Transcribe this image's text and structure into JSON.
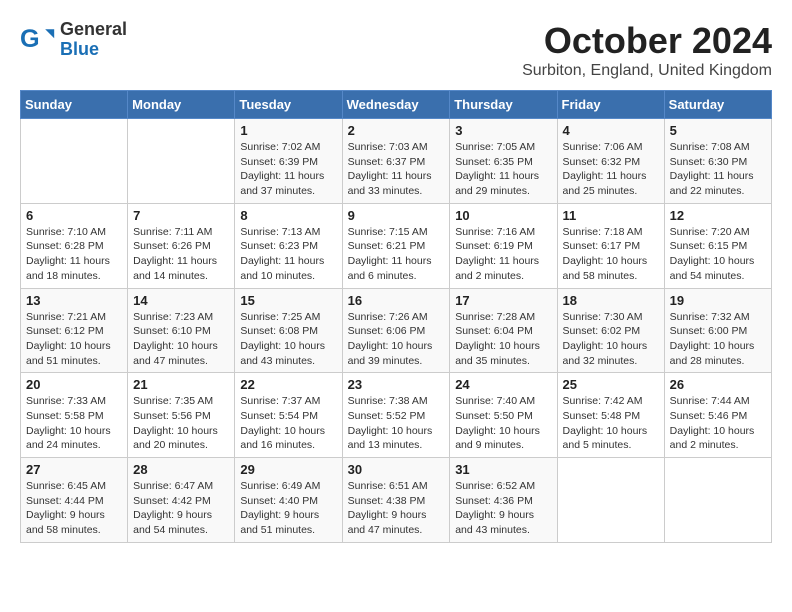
{
  "header": {
    "logo_general": "General",
    "logo_blue": "Blue",
    "month": "October 2024",
    "location": "Surbiton, England, United Kingdom"
  },
  "weekdays": [
    "Sunday",
    "Monday",
    "Tuesday",
    "Wednesday",
    "Thursday",
    "Friday",
    "Saturday"
  ],
  "weeks": [
    [
      {
        "day": "",
        "info": ""
      },
      {
        "day": "",
        "info": ""
      },
      {
        "day": "1",
        "info": "Sunrise: 7:02 AM\nSunset: 6:39 PM\nDaylight: 11 hours and 37 minutes."
      },
      {
        "day": "2",
        "info": "Sunrise: 7:03 AM\nSunset: 6:37 PM\nDaylight: 11 hours and 33 minutes."
      },
      {
        "day": "3",
        "info": "Sunrise: 7:05 AM\nSunset: 6:35 PM\nDaylight: 11 hours and 29 minutes."
      },
      {
        "day": "4",
        "info": "Sunrise: 7:06 AM\nSunset: 6:32 PM\nDaylight: 11 hours and 25 minutes."
      },
      {
        "day": "5",
        "info": "Sunrise: 7:08 AM\nSunset: 6:30 PM\nDaylight: 11 hours and 22 minutes."
      }
    ],
    [
      {
        "day": "6",
        "info": "Sunrise: 7:10 AM\nSunset: 6:28 PM\nDaylight: 11 hours and 18 minutes."
      },
      {
        "day": "7",
        "info": "Sunrise: 7:11 AM\nSunset: 6:26 PM\nDaylight: 11 hours and 14 minutes."
      },
      {
        "day": "8",
        "info": "Sunrise: 7:13 AM\nSunset: 6:23 PM\nDaylight: 11 hours and 10 minutes."
      },
      {
        "day": "9",
        "info": "Sunrise: 7:15 AM\nSunset: 6:21 PM\nDaylight: 11 hours and 6 minutes."
      },
      {
        "day": "10",
        "info": "Sunrise: 7:16 AM\nSunset: 6:19 PM\nDaylight: 11 hours and 2 minutes."
      },
      {
        "day": "11",
        "info": "Sunrise: 7:18 AM\nSunset: 6:17 PM\nDaylight: 10 hours and 58 minutes."
      },
      {
        "day": "12",
        "info": "Sunrise: 7:20 AM\nSunset: 6:15 PM\nDaylight: 10 hours and 54 minutes."
      }
    ],
    [
      {
        "day": "13",
        "info": "Sunrise: 7:21 AM\nSunset: 6:12 PM\nDaylight: 10 hours and 51 minutes."
      },
      {
        "day": "14",
        "info": "Sunrise: 7:23 AM\nSunset: 6:10 PM\nDaylight: 10 hours and 47 minutes."
      },
      {
        "day": "15",
        "info": "Sunrise: 7:25 AM\nSunset: 6:08 PM\nDaylight: 10 hours and 43 minutes."
      },
      {
        "day": "16",
        "info": "Sunrise: 7:26 AM\nSunset: 6:06 PM\nDaylight: 10 hours and 39 minutes."
      },
      {
        "day": "17",
        "info": "Sunrise: 7:28 AM\nSunset: 6:04 PM\nDaylight: 10 hours and 35 minutes."
      },
      {
        "day": "18",
        "info": "Sunrise: 7:30 AM\nSunset: 6:02 PM\nDaylight: 10 hours and 32 minutes."
      },
      {
        "day": "19",
        "info": "Sunrise: 7:32 AM\nSunset: 6:00 PM\nDaylight: 10 hours and 28 minutes."
      }
    ],
    [
      {
        "day": "20",
        "info": "Sunrise: 7:33 AM\nSunset: 5:58 PM\nDaylight: 10 hours and 24 minutes."
      },
      {
        "day": "21",
        "info": "Sunrise: 7:35 AM\nSunset: 5:56 PM\nDaylight: 10 hours and 20 minutes."
      },
      {
        "day": "22",
        "info": "Sunrise: 7:37 AM\nSunset: 5:54 PM\nDaylight: 10 hours and 16 minutes."
      },
      {
        "day": "23",
        "info": "Sunrise: 7:38 AM\nSunset: 5:52 PM\nDaylight: 10 hours and 13 minutes."
      },
      {
        "day": "24",
        "info": "Sunrise: 7:40 AM\nSunset: 5:50 PM\nDaylight: 10 hours and 9 minutes."
      },
      {
        "day": "25",
        "info": "Sunrise: 7:42 AM\nSunset: 5:48 PM\nDaylight: 10 hours and 5 minutes."
      },
      {
        "day": "26",
        "info": "Sunrise: 7:44 AM\nSunset: 5:46 PM\nDaylight: 10 hours and 2 minutes."
      }
    ],
    [
      {
        "day": "27",
        "info": "Sunrise: 6:45 AM\nSunset: 4:44 PM\nDaylight: 9 hours and 58 minutes."
      },
      {
        "day": "28",
        "info": "Sunrise: 6:47 AM\nSunset: 4:42 PM\nDaylight: 9 hours and 54 minutes."
      },
      {
        "day": "29",
        "info": "Sunrise: 6:49 AM\nSunset: 4:40 PM\nDaylight: 9 hours and 51 minutes."
      },
      {
        "day": "30",
        "info": "Sunrise: 6:51 AM\nSunset: 4:38 PM\nDaylight: 9 hours and 47 minutes."
      },
      {
        "day": "31",
        "info": "Sunrise: 6:52 AM\nSunset: 4:36 PM\nDaylight: 9 hours and 43 minutes."
      },
      {
        "day": "",
        "info": ""
      },
      {
        "day": "",
        "info": ""
      }
    ]
  ]
}
